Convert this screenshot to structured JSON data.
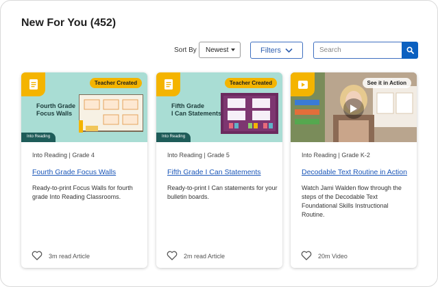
{
  "section": {
    "title": "New For You (452)"
  },
  "controls": {
    "sort_label": "Sort By",
    "sort_value": "Newest",
    "filters_label": "Filters",
    "search_placeholder": "Search"
  },
  "cards": [
    {
      "thumb_tag": "Teacher Created",
      "thumb_heading_1": "Fourth Grade",
      "thumb_heading_2": "Focus Walls",
      "thumb_footer": "Into Reading",
      "badge_icon": "document-icon",
      "meta": "Into Reading  |  Grade 4",
      "title": "Fourth Grade Focus Walls",
      "description": "Ready-to-print Focus Walls for fourth grade Into Reading Classrooms.",
      "footer": "3m read Article"
    },
    {
      "thumb_tag": "Teacher Created",
      "thumb_heading_1": "Fifth Grade",
      "thumb_heading_2": "I Can Statements",
      "thumb_footer": "Into Reading",
      "badge_icon": "document-icon",
      "meta": "Into Reading  |  Grade 5",
      "title": "Fifth Grade I Can Statements",
      "description": "Ready-to-print I Can statements for your bulletin boards.",
      "footer": "2m read Article"
    },
    {
      "thumb_tag": "See it in Action",
      "badge_icon": "play-icon",
      "meta": "Into Reading  |  Grade K-2",
      "title": "Decodable Text Routine in Action",
      "description": "Watch Jami Walden flow through the steps of the Decodable Text Foundational Skills Instructional Routine.",
      "footer": "20m Video"
    }
  ],
  "colors": {
    "accent_blue": "#0b60c0",
    "badge_yellow": "#f4b400",
    "thumb_teal": "#a9ddd4",
    "link_blue": "#1a56b8"
  }
}
